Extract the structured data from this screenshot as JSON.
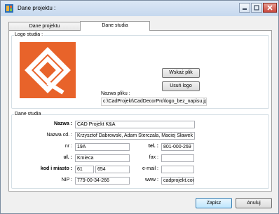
{
  "window": {
    "title": "Dane projektu :"
  },
  "tabs": [
    {
      "label": "Dane projektu"
    },
    {
      "label": "Dane studia"
    }
  ],
  "logo_group": {
    "legend": "Logo studia :",
    "show_button": "Wskaż plik",
    "remove_button": "Usuń logo",
    "file_label": "Nazwa pliku :",
    "file_path": "c:\\CadProjekt\\CadDecorPro\\logo_bez_napisu.jpg"
  },
  "studio_group": {
    "legend": "Dane studia",
    "nazwa_label": "Nazwa :",
    "nazwa_value": "CAD Projekt K&A",
    "nazwa_cd_label": "Nazwa cd. :",
    "nazwa_cd_value": "Krzysztof Dabrowski, Adam Sterczala, Maciej Sławek",
    "nr_label": "nr :",
    "nr_value": "19A",
    "tel_label": "tel. :",
    "tel_value": "801-000-269",
    "ul_label": "ul. :",
    "ul_value": "Kmieca",
    "fax_label": "fax :",
    "fax_value": "",
    "kod_label": "kod i miasto :",
    "kod_value": "61",
    "miasto_value": "654",
    "email_label": "e-mail :",
    "email_value": "",
    "nip_label": "NIP :",
    "nip_value": "779-00-34-266",
    "www_label": "www :",
    "www_value": "cadprojekt.com.pl"
  },
  "footer": {
    "save": "Zapisz",
    "cancel": "Anuluj"
  },
  "colors": {
    "logo_orange": "#e8632a",
    "titlebar": "#c6d8ee",
    "close_red": "#c8463c"
  }
}
